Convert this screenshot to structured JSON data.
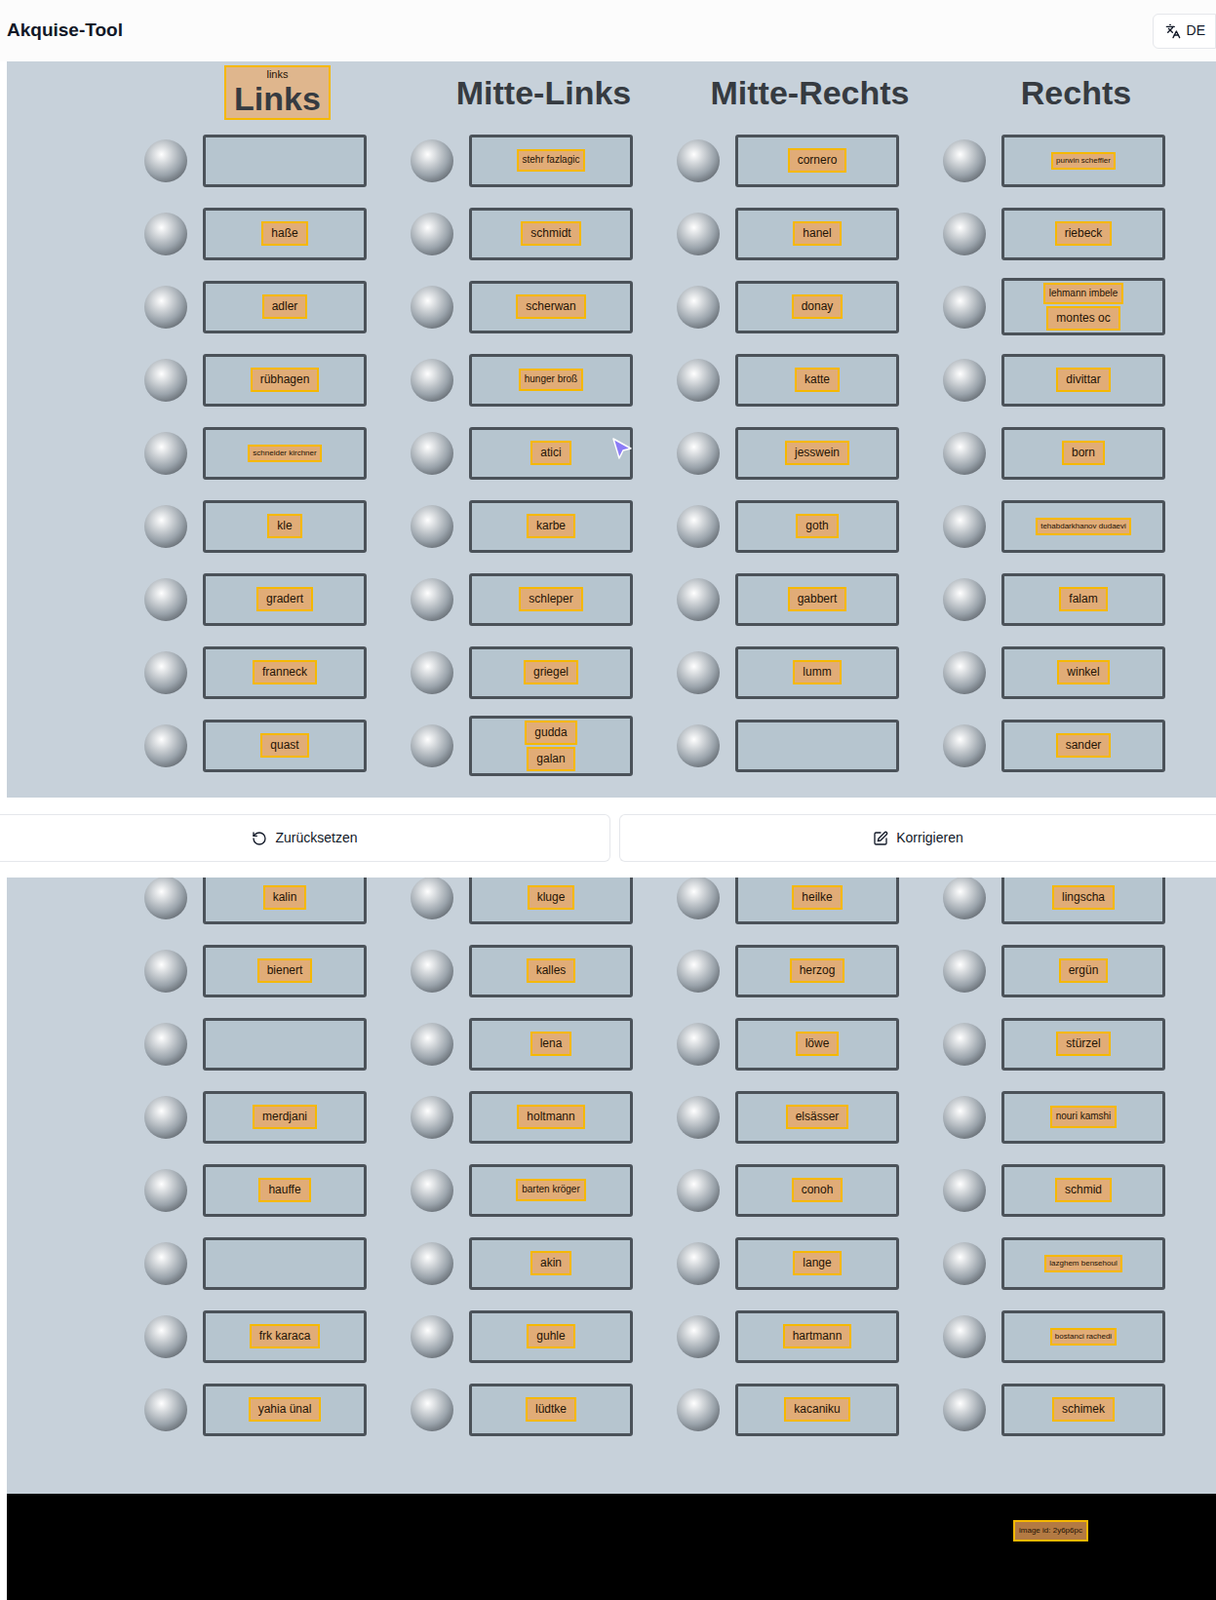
{
  "app": {
    "title": "Akquise-Tool",
    "language": "DE"
  },
  "panels": [
    {
      "headers": [
        {
          "label": "Links",
          "highlight": "links"
        },
        {
          "label": "Mitte-Links"
        },
        {
          "label": "Mitte-Rechts"
        },
        {
          "label": "Rechts"
        }
      ],
      "rows": [
        {
          "cells": [
            [],
            [
              "stehr fazlagic"
            ],
            [
              "cornero"
            ],
            [
              "purwin scheffler"
            ]
          ]
        },
        {
          "cells": [
            [
              "haße"
            ],
            [
              "schmidt"
            ],
            [
              "hanel"
            ],
            [
              "riebeck"
            ]
          ]
        },
        {
          "cells": [
            [
              "adler"
            ],
            [
              "scherwan"
            ],
            [
              "donay"
            ],
            [
              "lehmann imbele",
              "montes oc"
            ]
          ]
        },
        {
          "cells": [
            [
              "rübhagen"
            ],
            [
              "hunger broß"
            ],
            [
              "katte"
            ],
            [
              "divittar"
            ]
          ]
        },
        {
          "cells": [
            [
              "schneider kirchner"
            ],
            [
              "atici"
            ],
            [
              "jesswein"
            ],
            [
              "born"
            ]
          ]
        },
        {
          "cells": [
            [
              "kle"
            ],
            [
              "karbe"
            ],
            [
              "goth"
            ],
            [
              "tehabdarkhanov dudaevi"
            ]
          ]
        },
        {
          "cells": [
            [
              "gradert"
            ],
            [
              "schleper"
            ],
            [
              "gabbert"
            ],
            [
              "falam"
            ]
          ]
        },
        {
          "cells": [
            [
              "franneck"
            ],
            [
              "griegel"
            ],
            [
              "lumm"
            ],
            [
              "winkel"
            ]
          ]
        },
        {
          "cells": [
            [
              "quast"
            ],
            [
              "gudda",
              "galan"
            ],
            [],
            [
              "sander"
            ]
          ]
        }
      ]
    },
    {
      "headers": [],
      "rows": [
        {
          "cells": [
            [
              "kalin"
            ],
            [
              "kluge"
            ],
            [
              "heilke"
            ],
            [
              "lingscha"
            ]
          ]
        },
        {
          "cells": [
            [
              "bienert"
            ],
            [
              "kalles"
            ],
            [
              "herzog"
            ],
            [
              "ergün"
            ]
          ]
        },
        {
          "cells": [
            [],
            [
              "lena"
            ],
            [
              "löwe"
            ],
            [
              "stürzel"
            ]
          ]
        },
        {
          "cells": [
            [
              "merdjani"
            ],
            [
              "holtmann"
            ],
            [
              "elsässer"
            ],
            [
              "nouri kamshi"
            ]
          ]
        },
        {
          "cells": [
            [
              "hauffe"
            ],
            [
              "barten kröger"
            ],
            [
              "conoh"
            ],
            [
              "schmid"
            ]
          ]
        },
        {
          "cells": [
            [],
            [
              "akin"
            ],
            [
              "lange"
            ],
            [
              "lazghem bensehoul"
            ]
          ]
        },
        {
          "cells": [
            [
              "frk karaca"
            ],
            [
              "guhle"
            ],
            [
              "hartmann"
            ],
            [
              "bostanci rachedi"
            ]
          ]
        },
        {
          "cells": [
            [
              "yahia ünal"
            ],
            [
              "lüdtke"
            ],
            [
              "kacaniku"
            ],
            [
              "schimek"
            ]
          ]
        }
      ]
    }
  ],
  "actions": [
    {
      "label": "Zurücksetzen"
    },
    {
      "label": "Korrigieren"
    }
  ],
  "image_id_label": "image id: 2y6p6pc"
}
